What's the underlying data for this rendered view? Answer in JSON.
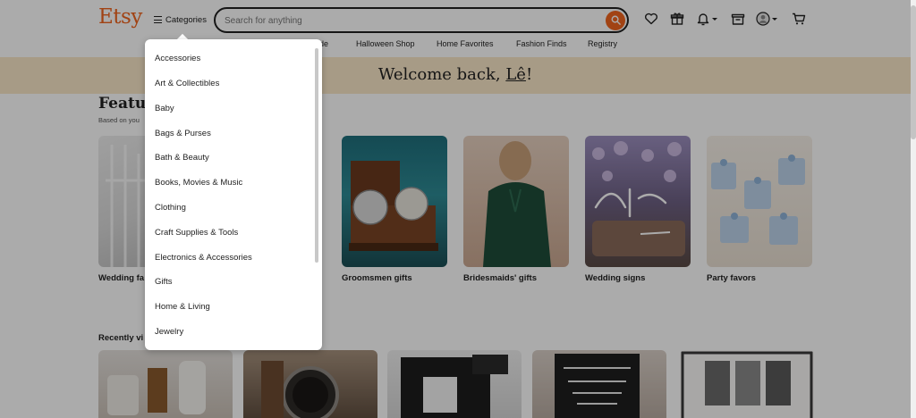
{
  "header": {
    "logo": "Etsy",
    "categories_label": "Categories",
    "search_placeholder": "Search for anything",
    "icons": [
      "heart-icon",
      "gift-icon",
      "bell-icon",
      "registry-icon",
      "avatar",
      "cart-icon"
    ]
  },
  "nav": {
    "items": [
      "de",
      "Halloween Shop",
      "Home Favorites",
      "Fashion Finds",
      "Registry"
    ]
  },
  "banner": {
    "prefix": "Welcome back, ",
    "name": "Lê",
    "suffix": "!"
  },
  "featured": {
    "title": "Featur",
    "subtitle": "Based on you",
    "cards": [
      "Wedding fa",
      "Groomsmen gifts",
      "Bridesmaids' gifts",
      "Wedding signs",
      "Party favors"
    ]
  },
  "recently_viewed": {
    "title": "Recently vi"
  },
  "dropdown": {
    "items": [
      "Accessories",
      "Art & Collectibles",
      "Baby",
      "Bags & Purses",
      "Bath & Beauty",
      "Books, Movies & Music",
      "Clothing",
      "Craft Supplies & Tools",
      "Electronics & Accessories",
      "Gifts",
      "Home & Living",
      "Jewelry"
    ]
  },
  "colors": {
    "brand": "#f1641e",
    "banner": "#fae8c8"
  }
}
